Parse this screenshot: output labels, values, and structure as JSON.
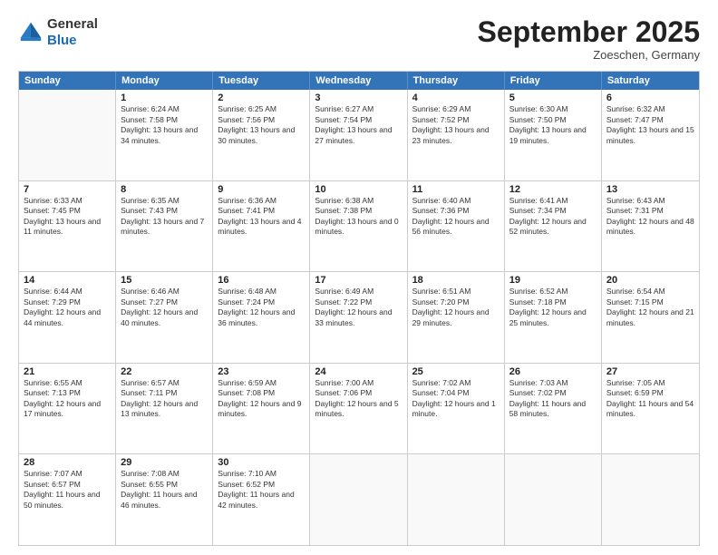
{
  "logo": {
    "general": "General",
    "blue": "Blue"
  },
  "header": {
    "month": "September 2025",
    "location": "Zoeschen, Germany"
  },
  "days": [
    "Sunday",
    "Monday",
    "Tuesday",
    "Wednesday",
    "Thursday",
    "Friday",
    "Saturday"
  ],
  "rows": [
    [
      {
        "day": "",
        "sunrise": "",
        "sunset": "",
        "daylight": "",
        "empty": true
      },
      {
        "day": "1",
        "sunrise": "Sunrise: 6:24 AM",
        "sunset": "Sunset: 7:58 PM",
        "daylight": "Daylight: 13 hours and 34 minutes."
      },
      {
        "day": "2",
        "sunrise": "Sunrise: 6:25 AM",
        "sunset": "Sunset: 7:56 PM",
        "daylight": "Daylight: 13 hours and 30 minutes."
      },
      {
        "day": "3",
        "sunrise": "Sunrise: 6:27 AM",
        "sunset": "Sunset: 7:54 PM",
        "daylight": "Daylight: 13 hours and 27 minutes."
      },
      {
        "day": "4",
        "sunrise": "Sunrise: 6:29 AM",
        "sunset": "Sunset: 7:52 PM",
        "daylight": "Daylight: 13 hours and 23 minutes."
      },
      {
        "day": "5",
        "sunrise": "Sunrise: 6:30 AM",
        "sunset": "Sunset: 7:50 PM",
        "daylight": "Daylight: 13 hours and 19 minutes."
      },
      {
        "day": "6",
        "sunrise": "Sunrise: 6:32 AM",
        "sunset": "Sunset: 7:47 PM",
        "daylight": "Daylight: 13 hours and 15 minutes."
      }
    ],
    [
      {
        "day": "7",
        "sunrise": "Sunrise: 6:33 AM",
        "sunset": "Sunset: 7:45 PM",
        "daylight": "Daylight: 13 hours and 11 minutes."
      },
      {
        "day": "8",
        "sunrise": "Sunrise: 6:35 AM",
        "sunset": "Sunset: 7:43 PM",
        "daylight": "Daylight: 13 hours and 7 minutes."
      },
      {
        "day": "9",
        "sunrise": "Sunrise: 6:36 AM",
        "sunset": "Sunset: 7:41 PM",
        "daylight": "Daylight: 13 hours and 4 minutes."
      },
      {
        "day": "10",
        "sunrise": "Sunrise: 6:38 AM",
        "sunset": "Sunset: 7:38 PM",
        "daylight": "Daylight: 13 hours and 0 minutes."
      },
      {
        "day": "11",
        "sunrise": "Sunrise: 6:40 AM",
        "sunset": "Sunset: 7:36 PM",
        "daylight": "Daylight: 12 hours and 56 minutes."
      },
      {
        "day": "12",
        "sunrise": "Sunrise: 6:41 AM",
        "sunset": "Sunset: 7:34 PM",
        "daylight": "Daylight: 12 hours and 52 minutes."
      },
      {
        "day": "13",
        "sunrise": "Sunrise: 6:43 AM",
        "sunset": "Sunset: 7:31 PM",
        "daylight": "Daylight: 12 hours and 48 minutes."
      }
    ],
    [
      {
        "day": "14",
        "sunrise": "Sunrise: 6:44 AM",
        "sunset": "Sunset: 7:29 PM",
        "daylight": "Daylight: 12 hours and 44 minutes."
      },
      {
        "day": "15",
        "sunrise": "Sunrise: 6:46 AM",
        "sunset": "Sunset: 7:27 PM",
        "daylight": "Daylight: 12 hours and 40 minutes."
      },
      {
        "day": "16",
        "sunrise": "Sunrise: 6:48 AM",
        "sunset": "Sunset: 7:24 PM",
        "daylight": "Daylight: 12 hours and 36 minutes."
      },
      {
        "day": "17",
        "sunrise": "Sunrise: 6:49 AM",
        "sunset": "Sunset: 7:22 PM",
        "daylight": "Daylight: 12 hours and 33 minutes."
      },
      {
        "day": "18",
        "sunrise": "Sunrise: 6:51 AM",
        "sunset": "Sunset: 7:20 PM",
        "daylight": "Daylight: 12 hours and 29 minutes."
      },
      {
        "day": "19",
        "sunrise": "Sunrise: 6:52 AM",
        "sunset": "Sunset: 7:18 PM",
        "daylight": "Daylight: 12 hours and 25 minutes."
      },
      {
        "day": "20",
        "sunrise": "Sunrise: 6:54 AM",
        "sunset": "Sunset: 7:15 PM",
        "daylight": "Daylight: 12 hours and 21 minutes."
      }
    ],
    [
      {
        "day": "21",
        "sunrise": "Sunrise: 6:55 AM",
        "sunset": "Sunset: 7:13 PM",
        "daylight": "Daylight: 12 hours and 17 minutes."
      },
      {
        "day": "22",
        "sunrise": "Sunrise: 6:57 AM",
        "sunset": "Sunset: 7:11 PM",
        "daylight": "Daylight: 12 hours and 13 minutes."
      },
      {
        "day": "23",
        "sunrise": "Sunrise: 6:59 AM",
        "sunset": "Sunset: 7:08 PM",
        "daylight": "Daylight: 12 hours and 9 minutes."
      },
      {
        "day": "24",
        "sunrise": "Sunrise: 7:00 AM",
        "sunset": "Sunset: 7:06 PM",
        "daylight": "Daylight: 12 hours and 5 minutes."
      },
      {
        "day": "25",
        "sunrise": "Sunrise: 7:02 AM",
        "sunset": "Sunset: 7:04 PM",
        "daylight": "Daylight: 12 hours and 1 minute."
      },
      {
        "day": "26",
        "sunrise": "Sunrise: 7:03 AM",
        "sunset": "Sunset: 7:02 PM",
        "daylight": "Daylight: 11 hours and 58 minutes."
      },
      {
        "day": "27",
        "sunrise": "Sunrise: 7:05 AM",
        "sunset": "Sunset: 6:59 PM",
        "daylight": "Daylight: 11 hours and 54 minutes."
      }
    ],
    [
      {
        "day": "28",
        "sunrise": "Sunrise: 7:07 AM",
        "sunset": "Sunset: 6:57 PM",
        "daylight": "Daylight: 11 hours and 50 minutes."
      },
      {
        "day": "29",
        "sunrise": "Sunrise: 7:08 AM",
        "sunset": "Sunset: 6:55 PM",
        "daylight": "Daylight: 11 hours and 46 minutes."
      },
      {
        "day": "30",
        "sunrise": "Sunrise: 7:10 AM",
        "sunset": "Sunset: 6:52 PM",
        "daylight": "Daylight: 11 hours and 42 minutes."
      },
      {
        "day": "",
        "sunrise": "",
        "sunset": "",
        "daylight": "",
        "empty": true
      },
      {
        "day": "",
        "sunrise": "",
        "sunset": "",
        "daylight": "",
        "empty": true
      },
      {
        "day": "",
        "sunrise": "",
        "sunset": "",
        "daylight": "",
        "empty": true
      },
      {
        "day": "",
        "sunrise": "",
        "sunset": "",
        "daylight": "",
        "empty": true
      }
    ]
  ]
}
